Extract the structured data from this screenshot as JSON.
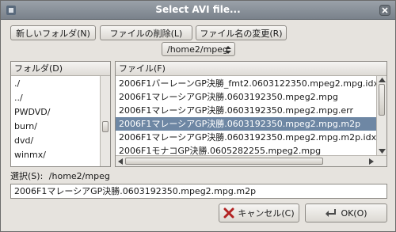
{
  "window": {
    "title": "Select AVI file..."
  },
  "toolbar": {
    "new_folder": "新しいフォルダ(N)",
    "delete_file": "ファイルの削除(L)",
    "rename_file": "ファイル名の変更(R)"
  },
  "path_combo": {
    "value": "/home2/mpeg"
  },
  "folders": {
    "header": "フォルダ(D)",
    "items": [
      "./",
      "../",
      "PWDVD/",
      "burn/",
      "dvd/",
      "winmx/"
    ]
  },
  "files": {
    "header": "ファイル(F)",
    "items": [
      "2006F1バーレーンGP決勝_fmt2.0603122350.mpeg2.mpg.idx",
      "2006F1マレーシアGP決勝.0603192350.mpeg2.mpg",
      "2006F1マレーシアGP決勝.0603192350.mpeg2.mpg.err",
      "2006F1マレーシアGP決勝.0603192350.mpeg2.mpg.m2p",
      "2006F1マレーシアGP決勝.0603192350.mpeg2.mpg.m2p.idx",
      "2006F1モナコGP決勝.0605282255.mpeg2.mpg"
    ],
    "selected_index": 3
  },
  "selection": {
    "label": "選択(S):",
    "path": "/home2/mpeg",
    "value": "2006F1マレーシアGP決勝.0603192350.mpeg2.mpg.m2p"
  },
  "buttons": {
    "cancel": "キャンセル(C)",
    "ok": "OK(O)"
  },
  "colors": {
    "selection": "#6e87a4",
    "titlebar": "#8a929b"
  }
}
